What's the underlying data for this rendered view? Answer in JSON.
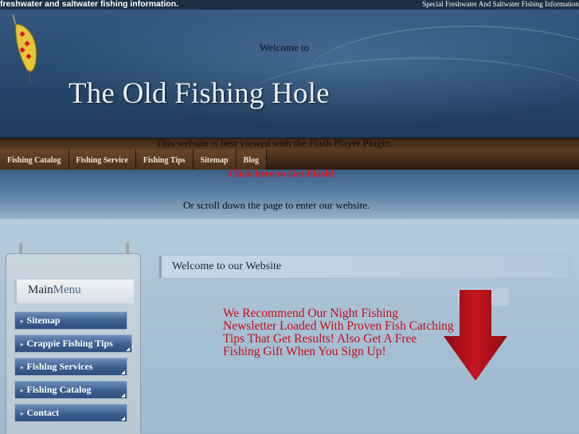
{
  "topbar": {
    "left_text": "freshwater and saltwater fishing information.",
    "right_text": "Special Freshwater And Saltwater Fishing Information"
  },
  "header": {
    "welcome_to": "Welcome to",
    "site_title": "The Old Fishing Hole"
  },
  "nav": {
    "items": [
      {
        "label": "Fishing Catalog"
      },
      {
        "label": "Fishing Service"
      },
      {
        "label": "Fishing Tips"
      },
      {
        "label": "Sitemap"
      },
      {
        "label": "Blog"
      }
    ]
  },
  "flash": {
    "note": "This website is best viewed with the Flash Player Plugin.",
    "link": "Click here to Get Flash!",
    "scroll_note": "Or scroll down the page to enter our website."
  },
  "sidebar": {
    "title_main": "Main",
    "title_menu": "Menu",
    "items": [
      {
        "label": "Sitemap"
      },
      {
        "label": "Crappie Fishing Tips"
      },
      {
        "label": "Fishing Services"
      },
      {
        "label": "Fishing Catalog"
      },
      {
        "label": "Contact"
      }
    ]
  },
  "main": {
    "header": "Welcome to our Website",
    "promo": "We Recommend Our Night Fishing Newsletter Loaded With Proven Fish Catching Tips That Get Results! Also Get A Free Fishing Gift When You Sign Up!"
  },
  "colors": {
    "promo_text": "#c0101a",
    "flash_link": "#e4131b",
    "arrow": "#b0101a"
  }
}
